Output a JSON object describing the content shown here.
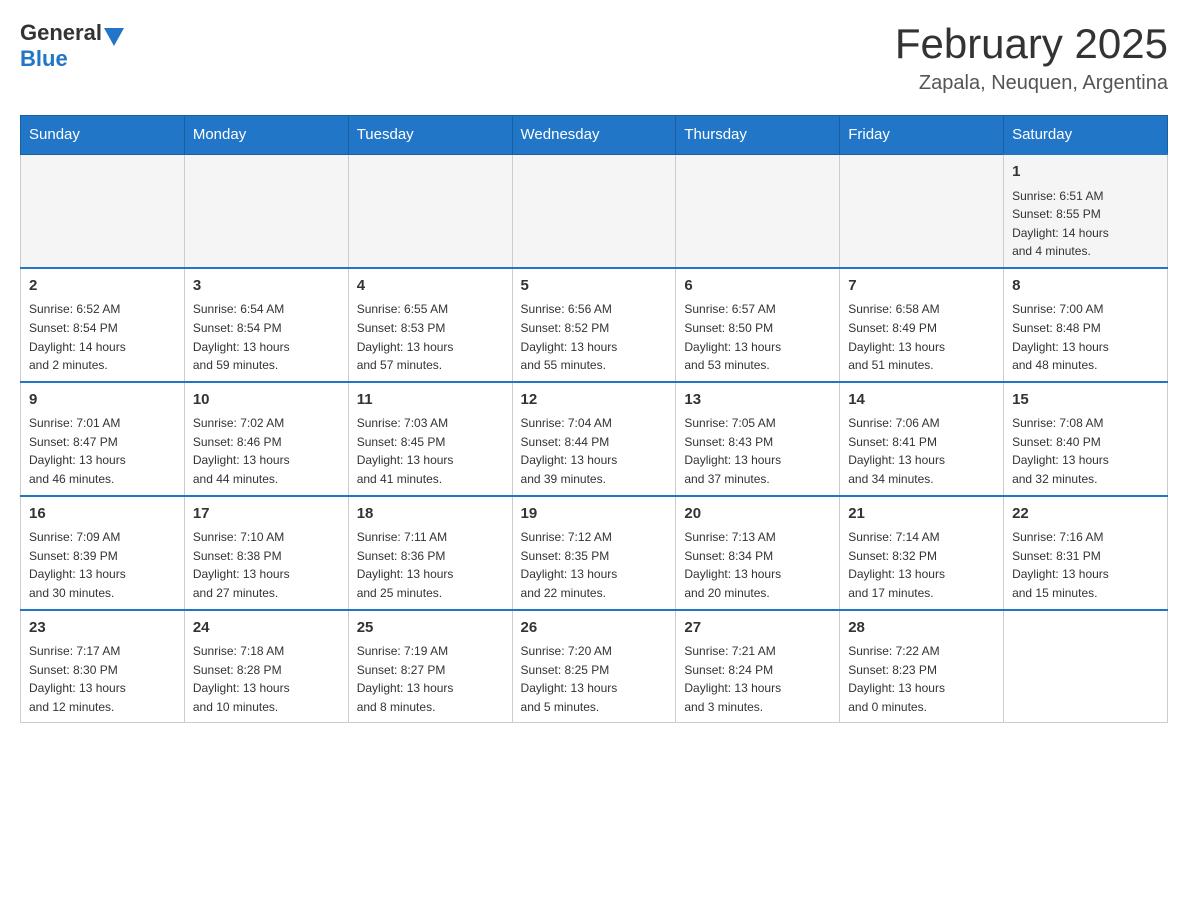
{
  "header": {
    "logo_general": "General",
    "logo_blue": "Blue",
    "month_title": "February 2025",
    "location": "Zapala, Neuquen, Argentina"
  },
  "weekdays": [
    "Sunday",
    "Monday",
    "Tuesday",
    "Wednesday",
    "Thursday",
    "Friday",
    "Saturday"
  ],
  "weeks": [
    [
      {
        "day": "",
        "info": ""
      },
      {
        "day": "",
        "info": ""
      },
      {
        "day": "",
        "info": ""
      },
      {
        "day": "",
        "info": ""
      },
      {
        "day": "",
        "info": ""
      },
      {
        "day": "",
        "info": ""
      },
      {
        "day": "1",
        "info": "Sunrise: 6:51 AM\nSunset: 8:55 PM\nDaylight: 14 hours\nand 4 minutes."
      }
    ],
    [
      {
        "day": "2",
        "info": "Sunrise: 6:52 AM\nSunset: 8:54 PM\nDaylight: 14 hours\nand 2 minutes."
      },
      {
        "day": "3",
        "info": "Sunrise: 6:54 AM\nSunset: 8:54 PM\nDaylight: 13 hours\nand 59 minutes."
      },
      {
        "day": "4",
        "info": "Sunrise: 6:55 AM\nSunset: 8:53 PM\nDaylight: 13 hours\nand 57 minutes."
      },
      {
        "day": "5",
        "info": "Sunrise: 6:56 AM\nSunset: 8:52 PM\nDaylight: 13 hours\nand 55 minutes."
      },
      {
        "day": "6",
        "info": "Sunrise: 6:57 AM\nSunset: 8:50 PM\nDaylight: 13 hours\nand 53 minutes."
      },
      {
        "day": "7",
        "info": "Sunrise: 6:58 AM\nSunset: 8:49 PM\nDaylight: 13 hours\nand 51 minutes."
      },
      {
        "day": "8",
        "info": "Sunrise: 7:00 AM\nSunset: 8:48 PM\nDaylight: 13 hours\nand 48 minutes."
      }
    ],
    [
      {
        "day": "9",
        "info": "Sunrise: 7:01 AM\nSunset: 8:47 PM\nDaylight: 13 hours\nand 46 minutes."
      },
      {
        "day": "10",
        "info": "Sunrise: 7:02 AM\nSunset: 8:46 PM\nDaylight: 13 hours\nand 44 minutes."
      },
      {
        "day": "11",
        "info": "Sunrise: 7:03 AM\nSunset: 8:45 PM\nDaylight: 13 hours\nand 41 minutes."
      },
      {
        "day": "12",
        "info": "Sunrise: 7:04 AM\nSunset: 8:44 PM\nDaylight: 13 hours\nand 39 minutes."
      },
      {
        "day": "13",
        "info": "Sunrise: 7:05 AM\nSunset: 8:43 PM\nDaylight: 13 hours\nand 37 minutes."
      },
      {
        "day": "14",
        "info": "Sunrise: 7:06 AM\nSunset: 8:41 PM\nDaylight: 13 hours\nand 34 minutes."
      },
      {
        "day": "15",
        "info": "Sunrise: 7:08 AM\nSunset: 8:40 PM\nDaylight: 13 hours\nand 32 minutes."
      }
    ],
    [
      {
        "day": "16",
        "info": "Sunrise: 7:09 AM\nSunset: 8:39 PM\nDaylight: 13 hours\nand 30 minutes."
      },
      {
        "day": "17",
        "info": "Sunrise: 7:10 AM\nSunset: 8:38 PM\nDaylight: 13 hours\nand 27 minutes."
      },
      {
        "day": "18",
        "info": "Sunrise: 7:11 AM\nSunset: 8:36 PM\nDaylight: 13 hours\nand 25 minutes."
      },
      {
        "day": "19",
        "info": "Sunrise: 7:12 AM\nSunset: 8:35 PM\nDaylight: 13 hours\nand 22 minutes."
      },
      {
        "day": "20",
        "info": "Sunrise: 7:13 AM\nSunset: 8:34 PM\nDaylight: 13 hours\nand 20 minutes."
      },
      {
        "day": "21",
        "info": "Sunrise: 7:14 AM\nSunset: 8:32 PM\nDaylight: 13 hours\nand 17 minutes."
      },
      {
        "day": "22",
        "info": "Sunrise: 7:16 AM\nSunset: 8:31 PM\nDaylight: 13 hours\nand 15 minutes."
      }
    ],
    [
      {
        "day": "23",
        "info": "Sunrise: 7:17 AM\nSunset: 8:30 PM\nDaylight: 13 hours\nand 12 minutes."
      },
      {
        "day": "24",
        "info": "Sunrise: 7:18 AM\nSunset: 8:28 PM\nDaylight: 13 hours\nand 10 minutes."
      },
      {
        "day": "25",
        "info": "Sunrise: 7:19 AM\nSunset: 8:27 PM\nDaylight: 13 hours\nand 8 minutes."
      },
      {
        "day": "26",
        "info": "Sunrise: 7:20 AM\nSunset: 8:25 PM\nDaylight: 13 hours\nand 5 minutes."
      },
      {
        "day": "27",
        "info": "Sunrise: 7:21 AM\nSunset: 8:24 PM\nDaylight: 13 hours\nand 3 minutes."
      },
      {
        "day": "28",
        "info": "Sunrise: 7:22 AM\nSunset: 8:23 PM\nDaylight: 13 hours\nand 0 minutes."
      },
      {
        "day": "",
        "info": ""
      }
    ]
  ]
}
